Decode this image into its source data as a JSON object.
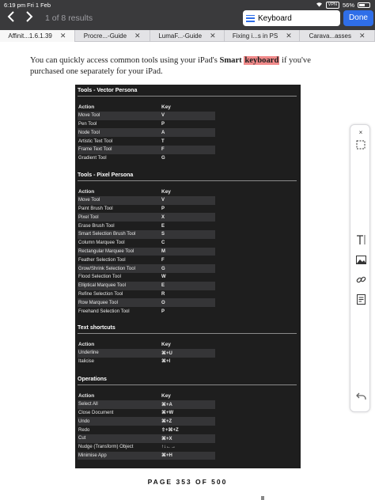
{
  "status": {
    "time": "6:19 pm",
    "date": "Fri 1 Feb",
    "vpn": "VPN",
    "battery": "56%",
    "battery_level": 0.56
  },
  "nav": {
    "back_icon": "chevron-left-icon",
    "forward_icon": "chevron-right-icon",
    "results": "1 of 8 results"
  },
  "search": {
    "value": "Keyboard",
    "done_label": "Done"
  },
  "tabs": [
    {
      "label": "Affinit...1.6.1.39",
      "active": true
    },
    {
      "label": "Procre...-Guide",
      "active": false
    },
    {
      "label": "LumaF...-Guide",
      "active": false
    },
    {
      "label": "Fixing i...s in PS",
      "active": false
    },
    {
      "label": "Carava...asses",
      "active": false
    }
  ],
  "doc": {
    "intro_before": "You can quickly access common tools using your iPad's ",
    "intro_bold": "Smart",
    "intro_highlight": "keyboard",
    "intro_after": " if you've purchased one separately for your iPad.",
    "page_label": "PAGE 353 OF 500"
  },
  "sections": [
    {
      "title": "Tools - Vector Persona",
      "header": {
        "action": "Action",
        "key": "Key"
      },
      "rows": [
        {
          "action": "Move Tool",
          "key": "V"
        },
        {
          "action": "Pen Tool",
          "key": "P"
        },
        {
          "action": "Node Tool",
          "key": "A"
        },
        {
          "action": "Artistic Text Tool",
          "key": "T"
        },
        {
          "action": "Frame Text Tool",
          "key": "F"
        },
        {
          "action": "Gradient Tool",
          "key": "G"
        }
      ]
    },
    {
      "title": "Tools - Pixel Persona",
      "header": {
        "action": "Action",
        "key": "Key"
      },
      "rows": [
        {
          "action": "Move Tool",
          "key": "V"
        },
        {
          "action": "Paint Brush Tool",
          "key": "P"
        },
        {
          "action": "Pixel Tool",
          "key": "X"
        },
        {
          "action": "Erase Brush Tool",
          "key": "E"
        },
        {
          "action": "Smart Selection Brush Tool",
          "key": "S"
        },
        {
          "action": "Column Marquee Tool",
          "key": "C"
        },
        {
          "action": "Rectangular Marquee Tool",
          "key": "M"
        },
        {
          "action": "Feather Selection Tool",
          "key": "F"
        },
        {
          "action": "Grow/Shrink Selection Tool",
          "key": "G"
        },
        {
          "action": "Flood Selection Tool",
          "key": "W"
        },
        {
          "action": "Elliptical Marquee Tool",
          "key": "E"
        },
        {
          "action": "Refine Selection Tool",
          "key": "R"
        },
        {
          "action": "Row Marquee Tool",
          "key": "O"
        },
        {
          "action": "Freehand Selection Tool",
          "key": "P"
        }
      ]
    },
    {
      "title": "Text shortcuts",
      "header": {
        "action": "Action",
        "key": "Key"
      },
      "rows": [
        {
          "action": "Underline",
          "key": "⌘+U"
        },
        {
          "action": "Italicise",
          "key": "⌘+I"
        }
      ]
    },
    {
      "title": "Operations",
      "header": {
        "action": "Action",
        "key": "Key"
      },
      "rows": [
        {
          "action": "Select All",
          "key": "⌘+A"
        },
        {
          "action": "Close Document",
          "key": "⌘+W"
        },
        {
          "action": "Undo",
          "key": "⌘+Z"
        },
        {
          "action": "Redo",
          "key": "⇧+⌘+Z"
        },
        {
          "action": "Cut",
          "key": "⌘+X"
        },
        {
          "action": "Nudge (Transform) Object",
          "key": "↑↓←→"
        },
        {
          "action": "Minimise App",
          "key": "⌘+H"
        }
      ]
    }
  ],
  "palette": {
    "close": "×",
    "items": [
      "marquee-select-icon",
      "text-tool-icon",
      "image-icon",
      "link-icon",
      "note-icon",
      "undo-icon"
    ]
  },
  "colors": {
    "toolbar": "#3a3a3c",
    "accent": "#2f6ee8",
    "highlight": "#f08a8a",
    "table_bg": "#1e1e1e"
  }
}
